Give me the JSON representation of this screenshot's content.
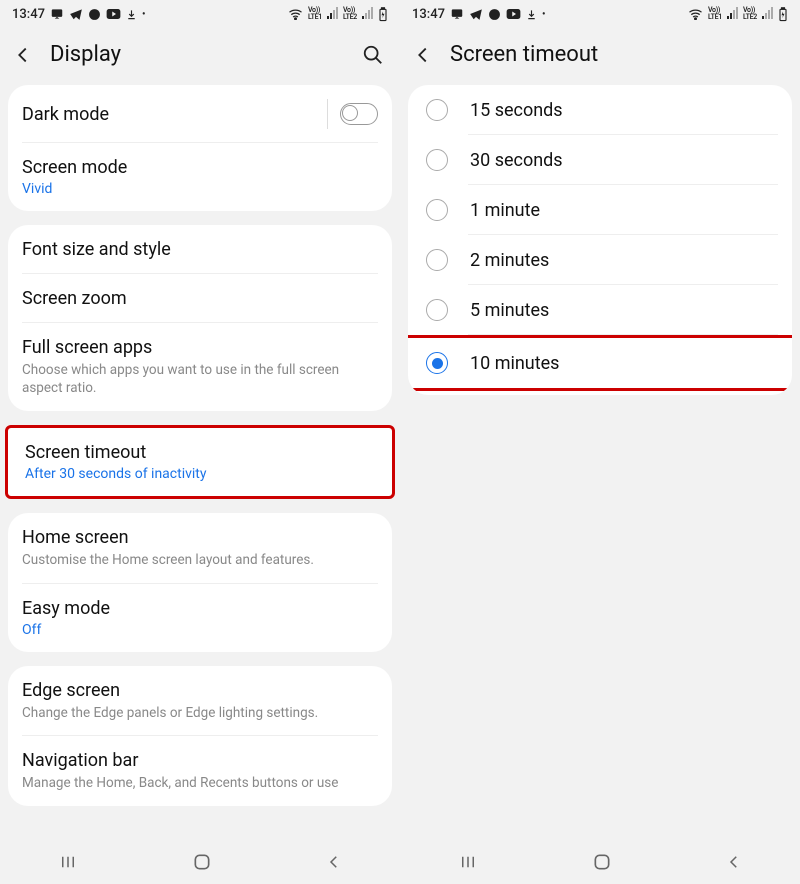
{
  "statusbar": {
    "time": "13:47",
    "lte1": "Vo)) LTE1",
    "lte2": "Vo)) LTE2"
  },
  "left_screen": {
    "title": "Display",
    "dark_mode": {
      "label": "Dark mode",
      "on": false
    },
    "screen_mode": {
      "label": "Screen mode",
      "value": "Vivid"
    },
    "font_size": {
      "label": "Font size and style"
    },
    "screen_zoom": {
      "label": "Screen zoom"
    },
    "full_screen": {
      "label": "Full screen apps",
      "sub": "Choose which apps you want to use in the full screen aspect ratio."
    },
    "screen_timeout": {
      "label": "Screen timeout",
      "value": "After 30 seconds of inactivity"
    },
    "home_screen": {
      "label": "Home screen",
      "sub": "Customise the Home screen layout and features."
    },
    "easy_mode": {
      "label": "Easy mode",
      "value": "Off"
    },
    "edge_screen": {
      "label": "Edge screen",
      "sub": "Change the Edge panels or Edge lighting settings."
    },
    "navigation_bar": {
      "label": "Navigation bar",
      "sub": "Manage the Home, Back, and Recents buttons or use"
    }
  },
  "right_screen": {
    "title": "Screen timeout",
    "options": [
      {
        "label": "15 seconds",
        "selected": false
      },
      {
        "label": "30 seconds",
        "selected": false
      },
      {
        "label": "1 minute",
        "selected": false
      },
      {
        "label": "2 minutes",
        "selected": false
      },
      {
        "label": "5 minutes",
        "selected": false
      },
      {
        "label": "10 minutes",
        "selected": true
      }
    ]
  }
}
